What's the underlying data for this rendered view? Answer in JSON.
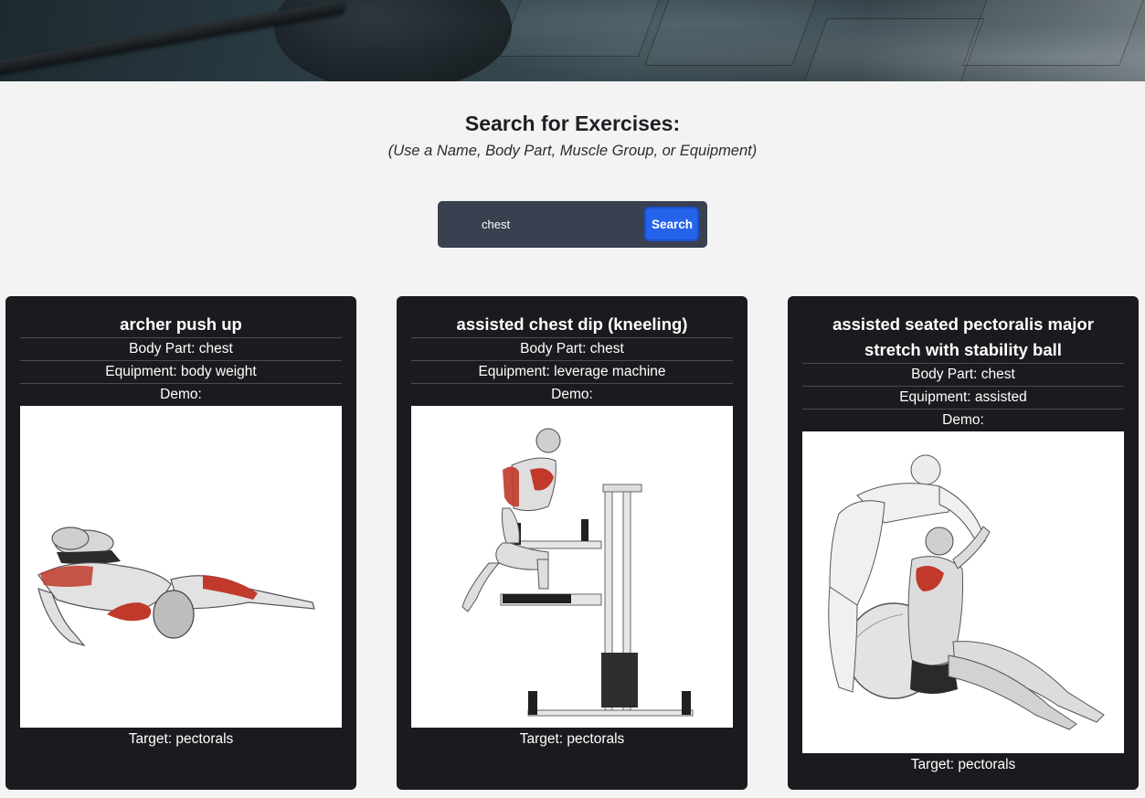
{
  "header": {
    "title": "Search for Exercises:",
    "subtitle": "(Use a Name, Body Part, Muscle Group, or Equipment)"
  },
  "search": {
    "value": "chest",
    "button_label": "Search"
  },
  "results": [
    {
      "name": "archer push up",
      "body_part": "Body Part: chest",
      "equipment": "Equipment: body weight",
      "demo_label": "Demo:",
      "target": "Target: pectorals"
    },
    {
      "name": "assisted chest dip (kneeling)",
      "body_part": "Body Part: chest",
      "equipment": "Equipment: leverage machine",
      "demo_label": "Demo:",
      "target": "Target: pectorals"
    },
    {
      "name": "assisted seated pectoralis major stretch with stability ball",
      "body_part": "Body Part: chest",
      "equipment": "Equipment: assisted",
      "demo_label": "Demo:",
      "target": "Target: pectorals"
    }
  ],
  "colors": {
    "page_background": "#f3f3f4",
    "card_background": "#1b1b1f",
    "search_background": "#394150",
    "accent": "#2563eb",
    "muscle_highlight": "#c0392b"
  }
}
